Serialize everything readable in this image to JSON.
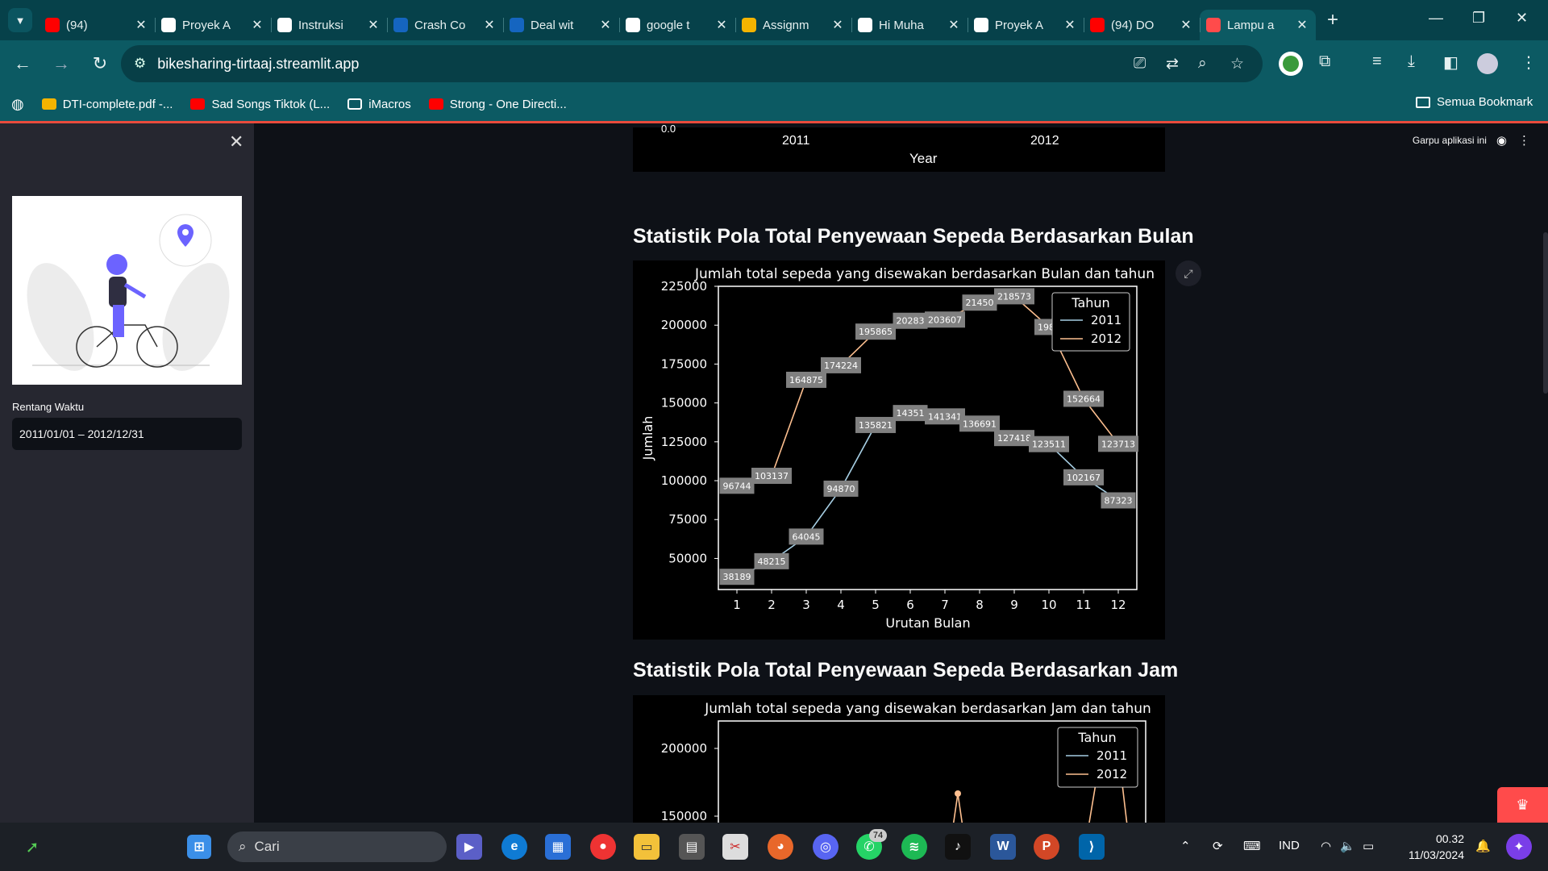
{
  "browser": {
    "tabs": [
      {
        "title": "(94)",
        "icon": "youtube-icon",
        "color": "#ff0000"
      },
      {
        "title": "Proyek A",
        "icon": "dicoding-icon",
        "color": "#ffffff"
      },
      {
        "title": "Instruksi",
        "icon": "dicoding-icon",
        "color": "#ffffff"
      },
      {
        "title": "Crash Co",
        "icon": "c-icon",
        "color": "#1565c0"
      },
      {
        "title": "Deal wit",
        "icon": "c-icon",
        "color": "#1565c0"
      },
      {
        "title": "google t",
        "icon": "google-icon",
        "color": "#ffffff"
      },
      {
        "title": "Assignm",
        "icon": "classroom-icon",
        "color": "#f4b400"
      },
      {
        "title": "Hi Muha",
        "icon": "gmail-icon",
        "color": "#ffffff"
      },
      {
        "title": "Proyek A",
        "icon": "dicoding-icon",
        "color": "#ffffff"
      },
      {
        "title": "(94) DO",
        "icon": "youtube-icon",
        "color": "#ff0000"
      },
      {
        "title": "Lampu a",
        "icon": "streamlit-icon",
        "color": "#ff4b4b"
      }
    ],
    "url": "bikesharing-tirtaaj.streamlit.app",
    "bookmarks": [
      {
        "label": "DTI-complete.pdf -...",
        "icon": "drive-icon"
      },
      {
        "label": "Sad Songs Tiktok (L...",
        "icon": "youtube-icon"
      },
      {
        "label": "iMacros",
        "icon": "folder-icon"
      },
      {
        "label": "Strong - One Directi...",
        "icon": "youtube-icon"
      }
    ],
    "all_bookmarks": "Semua Bookmark"
  },
  "sidebar": {
    "range_label": "Rentang Waktu",
    "range_value": "2011/01/01 – 2012/12/31"
  },
  "main": {
    "fork_label": "Garpu aplikasi ini",
    "section_month": "Statistik Pola Total Penyewaan Sepeda Berdasarkan Bulan",
    "section_hour": "Statistik Pola Total Penyewaan Sepeda Berdasarkan Jam"
  },
  "prev_chart": {
    "x_ticks": [
      "2011",
      "2012"
    ],
    "xlabel": "Year",
    "partial_tick": "0.0"
  },
  "chart_data": [
    {
      "type": "line",
      "title": "Jumlah total sepeda yang disewakan berdasarkan Bulan dan tahun",
      "xlabel": "Urutan Bulan",
      "ylabel": "Jumlah",
      "x": [
        1,
        2,
        3,
        4,
        5,
        6,
        7,
        8,
        9,
        10,
        11,
        12
      ],
      "ylim": [
        30000,
        225000
      ],
      "y_ticks": [
        50000,
        75000,
        100000,
        125000,
        150000,
        175000,
        200000,
        225000
      ],
      "legend_title": "Tahun",
      "legend_position": "top-right",
      "series": [
        {
          "name": "2011",
          "color": "#a6cee3",
          "values": [
            38189,
            48215,
            64045,
            94870,
            135821,
            143512,
            141341,
            136691,
            127418,
            123511,
            102167,
            87323
          ],
          "labels": [
            "38189",
            "48215",
            "64045",
            "94870",
            "135821",
            "14351",
            "141341",
            "136691",
            "127418",
            "123511",
            "102167",
            "87323"
          ]
        },
        {
          "name": "2012",
          "color": "#fdbf8f",
          "values": [
            96744,
            103137,
            164875,
            174224,
            195865,
            202830,
            203607,
            214503,
            218573,
            198841,
            152664,
            123713
          ],
          "labels": [
            "96744",
            "103137",
            "164875",
            "174224",
            "195865",
            "20283",
            "203607",
            "21450",
            "218573",
            "1988",
            "152664",
            "123713"
          ]
        }
      ]
    },
    {
      "type": "line",
      "title": "Jumlah total sepeda yang disewakan berdasarkan Jam dan tahun",
      "y_ticks": [
        150000,
        200000
      ],
      "legend_title": "Tahun",
      "legend_position": "top-right",
      "series": [
        {
          "name": "2011",
          "color": "#a6cee3"
        },
        {
          "name": "2012",
          "color": "#fdbf8f"
        }
      ]
    }
  ],
  "taskbar": {
    "search": "Cari",
    "whatsapp_badge": "74",
    "lang": "IND",
    "time": "00.32",
    "date": "11/03/2024"
  }
}
